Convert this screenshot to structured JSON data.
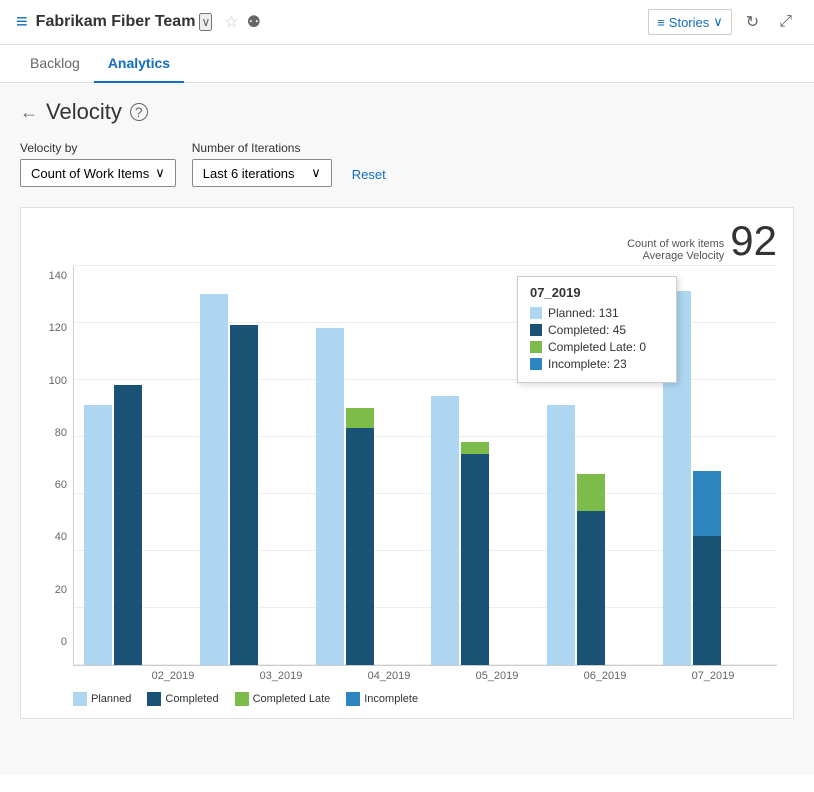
{
  "header": {
    "icon": "≡",
    "team_name": "Fabrikam Fiber Team",
    "chevron": "∨",
    "stories_label": "Stories",
    "refresh_icon": "↻",
    "expand_icon": "⤢"
  },
  "nav": {
    "tabs": [
      {
        "id": "backlog",
        "label": "Backlog",
        "active": false
      },
      {
        "id": "analytics",
        "label": "Analytics",
        "active": true
      }
    ]
  },
  "page": {
    "back_label": "←",
    "title": "Velocity",
    "help_label": "?",
    "velocity_by_label": "Velocity by",
    "velocity_by_value": "Count of Work Items",
    "iterations_label": "Number of Iterations",
    "iterations_value": "Last 6 iterations",
    "reset_label": "Reset",
    "chart_meta_label1": "Count of work items",
    "chart_meta_label2": "Average Velocity",
    "chart_meta_value": "92"
  },
  "y_axis": {
    "labels": [
      "0",
      "20",
      "40",
      "60",
      "80",
      "100",
      "120",
      "140"
    ]
  },
  "x_axis": {
    "labels": [
      "02_2019",
      "03_2019",
      "04_2019",
      "05_2019",
      "06_2019",
      "07_2019"
    ]
  },
  "chart": {
    "max_value": 140,
    "bar_groups": [
      {
        "label": "02_2019",
        "planned": 91,
        "completed": 98,
        "completedlate": 0,
        "incomplete": 0
      },
      {
        "label": "03_2019",
        "planned": 130,
        "completed": 119,
        "completedlate": 0,
        "incomplete": 0
      },
      {
        "label": "04_2019",
        "planned": 118,
        "completed": 83,
        "completedlate": 7,
        "incomplete": 0
      },
      {
        "label": "05_2019",
        "planned": 94,
        "completed": 74,
        "completedlate": 4,
        "incomplete": 0
      },
      {
        "label": "06_2019",
        "planned": 91,
        "completed": 54,
        "completedlate": 13,
        "incomplete": 0
      },
      {
        "label": "07_2019",
        "planned": 131,
        "completed": 45,
        "completedlate": 0,
        "incomplete": 23
      }
    ]
  },
  "tooltip": {
    "title": "07_2019",
    "rows": [
      {
        "color": "#aed6f1",
        "label": "Planned: 131"
      },
      {
        "color": "#1a5276",
        "label": "Completed: 45"
      },
      {
        "color": "#7dbb4b",
        "label": "Completed Late: 0"
      },
      {
        "color": "#2e86c1",
        "label": "Incomplete: 23"
      }
    ]
  },
  "legend": {
    "items": [
      {
        "id": "planned",
        "color": "#aed6f1",
        "label": "Planned"
      },
      {
        "id": "completed",
        "color": "#1a5276",
        "label": "Completed"
      },
      {
        "id": "completedlate",
        "color": "#7dbb4b",
        "label": "Completed Late"
      },
      {
        "id": "incomplete",
        "color": "#2e86c1",
        "label": "Incomplete"
      }
    ]
  }
}
